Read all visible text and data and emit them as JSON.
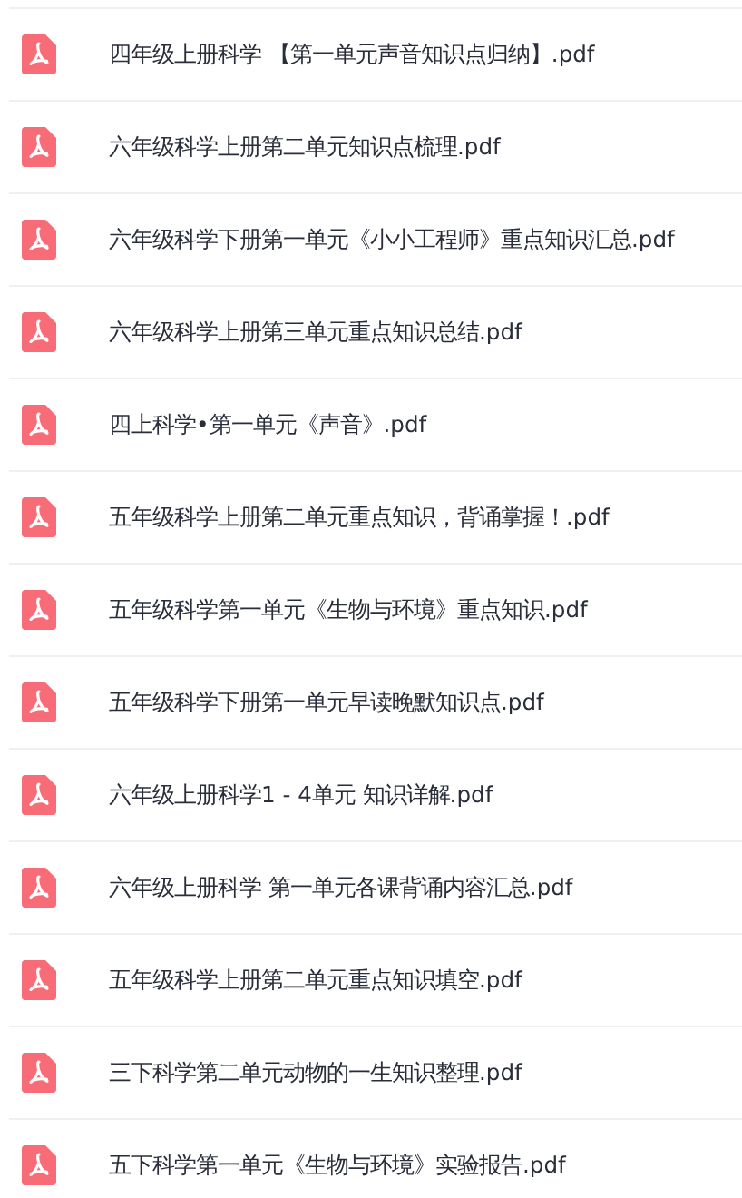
{
  "files": [
    {
      "name": "四年级上册科学 【第一单元声音知识点归纳】.pdf"
    },
    {
      "name": "六年级科学上册第二单元知识点梳理.pdf"
    },
    {
      "name": "六年级科学下册第一单元《小小工程师》重点知识汇总.pdf"
    },
    {
      "name": "六年级科学上册第三单元重点知识总结.pdf"
    },
    {
      "name": "四上科学•第一单元《声音》.pdf"
    },
    {
      "name": "五年级科学上册第二单元重点知识，背诵掌握！.pdf"
    },
    {
      "name": "五年级科学第一单元《生物与环境》重点知识.pdf"
    },
    {
      "name": "五年级科学下册第一单元早读晚默知识点.pdf"
    },
    {
      "name": "六年级上册科学1 - 4单元 知识详解.pdf"
    },
    {
      "name": "六年级上册科学 第一单元各课背诵内容汇总.pdf"
    },
    {
      "name": "五年级科学上册第二单元重点知识填空.pdf"
    },
    {
      "name": "三下科学第二单元动物的一生知识整理.pdf"
    },
    {
      "name": "五下科学第一单元《生物与环境》实验报告.pdf"
    }
  ]
}
